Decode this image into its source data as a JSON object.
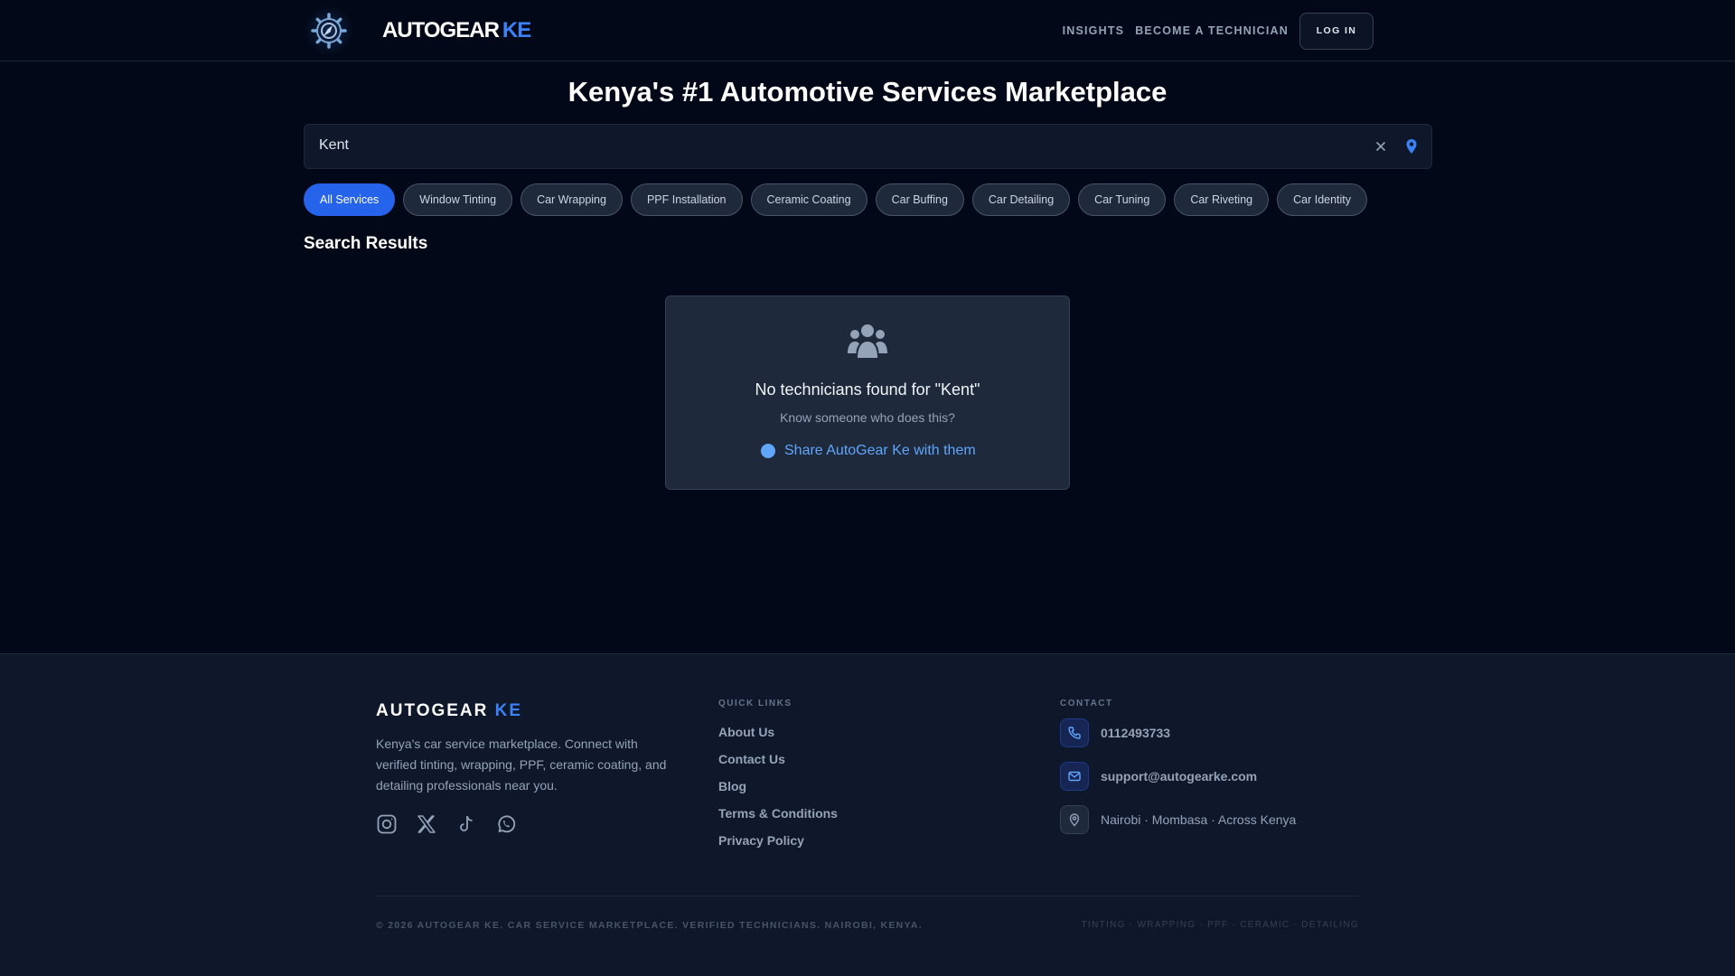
{
  "header": {
    "brand_main": "AUTOGEAR",
    "brand_accent": "KE",
    "nav": [
      "INSIGHTS",
      "BECOME A TECHNICIAN"
    ],
    "login_label": "LOG IN",
    "logo_icon": "gear-compass-icon"
  },
  "hero": {
    "title": "Kenya's #1 Automotive Services Marketplace"
  },
  "search": {
    "value": "Kent",
    "clear_icon": "close-icon",
    "location_icon": "map-pin-icon",
    "accent_color": "#3b82f6"
  },
  "categories": {
    "items": [
      "All Services",
      "Window Tinting",
      "Car Wrapping",
      "PPF Installation",
      "Ceramic Coating",
      "Car Buffing",
      "Car Detailing",
      "Car Tuning",
      "Car Riveting",
      "Car Identity"
    ],
    "active": "All Services",
    "active_color": "#2563eb"
  },
  "results": {
    "title": "Search Results",
    "empty": {
      "icon": "users-icon",
      "title": "No technicians found for \"Kent\"",
      "subtitle": "Know someone who does this?",
      "share_label": "Share AutoGear Ke with them"
    }
  },
  "footer": {
    "brand_main": "AUTOGEAR",
    "brand_accent": "KE",
    "description": "Kenya's car service marketplace. Connect with verified tinting, wrapping, PPF, ceramic coating, and detailing professionals near you.",
    "socials": [
      "instagram-icon",
      "x-icon",
      "tiktok-icon",
      "whatsapp-icon"
    ],
    "quick_links_heading": "QUICK LINKS",
    "quick_links": [
      "About Us",
      "Contact Us",
      "Blog",
      "Terms & Conditions",
      "Privacy Policy"
    ],
    "contact_heading": "CONTACT",
    "phone": "0112493733",
    "email": "support@autogearke.com",
    "locations": "Nairobi · Mombasa · Across Kenya",
    "copyright": "© 2026 AUTOGEAR KE. CAR SERVICE MARKETPLACE. VERIFIED TECHNICIANS. NAIROBI, KENYA.",
    "tags": "TINTING · WRAPPING · PPF · CERAMIC · DETAILING"
  }
}
